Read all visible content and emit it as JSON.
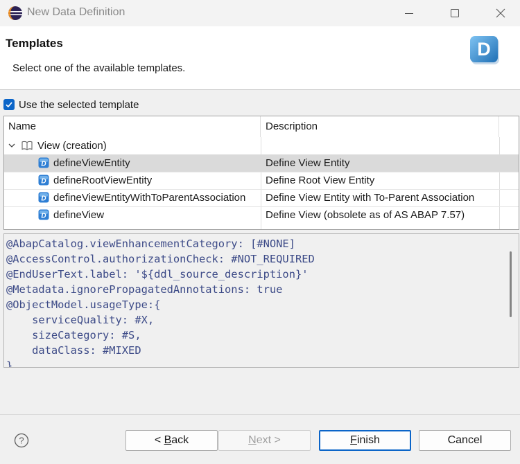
{
  "window": {
    "title": "New Data Definition",
    "icons": [
      "eclipse-icon",
      "minimize-icon",
      "maximize-icon",
      "close-icon"
    ]
  },
  "banner": {
    "title": "Templates",
    "message": "Select one of the available templates.",
    "logo_icon": "ddl-wizard-logo-icon",
    "logo_text": "D"
  },
  "use_template": {
    "label": "Use the selected template",
    "checked": true
  },
  "table": {
    "columns": [
      "Name",
      "Description"
    ],
    "group": {
      "label": "View (creation)",
      "expanded": true
    },
    "rows": [
      {
        "name": "defineViewEntity",
        "description": "Define View Entity",
        "selected": true
      },
      {
        "name": "defineRootViewEntity",
        "description": "Define Root View Entity",
        "selected": false
      },
      {
        "name": "defineViewEntityWithToParentAssociation",
        "description": "Define View Entity with To-Parent Association",
        "selected": false
      },
      {
        "name": "defineView",
        "description": "Define View (obsolete as of AS ABAP 7.57)",
        "selected": false
      }
    ]
  },
  "code_preview": {
    "lines": [
      "@AbapCatalog.viewEnhancementCategory: [#NONE]",
      "@AccessControl.authorizationCheck: #NOT_REQUIRED",
      "@EndUserText.label: '${ddl_source_description}'",
      "@Metadata.ignorePropagatedAnnotations: true",
      "@ObjectModel.usageType:{",
      "    serviceQuality: #X,",
      "    sizeCategory: #S,",
      "    dataClass: #MIXED",
      "}"
    ]
  },
  "footer": {
    "help_icon": "help-icon",
    "back": {
      "mnemonic": "B",
      "rest": "ack",
      "prefix": "< "
    },
    "next": {
      "mnemonic": "N",
      "rest": "ext",
      "suffix": " >",
      "enabled": false
    },
    "finish": {
      "mnemonic": "F",
      "rest": "inish"
    },
    "cancel": "Cancel"
  },
  "colors": {
    "accent": "#0a64c8",
    "selection": "#dadada",
    "code_text": "#3c4a87",
    "template_icon": "#2f7fd4"
  }
}
